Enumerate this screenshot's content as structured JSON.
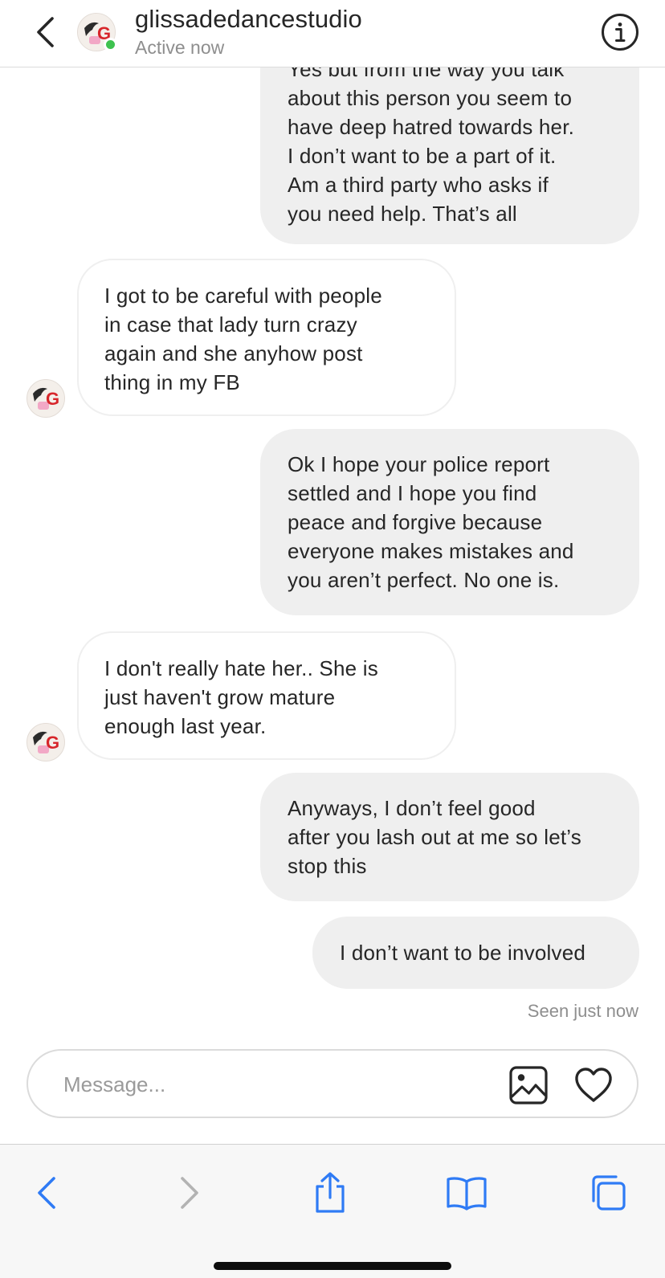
{
  "header": {
    "username": "glissadedancestudio",
    "status": "Active now"
  },
  "messages": [
    {
      "sender": "me",
      "lines": [
        "Yes but from the way you talk",
        "about this person you seem to",
        "have deep hatred towards her.",
        "I don’t want to be a part of it.",
        "Am a third party who asks if",
        "you need help. That’s all"
      ]
    },
    {
      "sender": "them",
      "lines": [
        "I got to be careful with people",
        "in case that lady turn crazy",
        "again and she anyhow post",
        "thing in my FB"
      ]
    },
    {
      "sender": "me",
      "lines": [
        "Ok I hope your police report",
        "settled and I hope you find",
        "peace and forgive because",
        "everyone makes mistakes and",
        "you aren’t perfect. No one is."
      ]
    },
    {
      "sender": "them",
      "lines": [
        "I don't really hate her.. She is",
        "just haven't grow mature",
        "enough last year."
      ]
    },
    {
      "sender": "me",
      "lines": [
        "Anyways, I don’t feel good",
        "after you lash out at me so let’s",
        "stop this"
      ]
    },
    {
      "sender": "me",
      "lines": [
        "I don’t want to be involved"
      ]
    }
  ],
  "seen_status": "Seen just now",
  "composer": {
    "placeholder": "Message..."
  },
  "icons": {
    "back": "chevron-left-icon",
    "info": "info-icon",
    "gallery": "image-icon",
    "like": "heart-icon",
    "browser_back": "browser-back-icon",
    "browser_forward": "browser-forward-icon",
    "share": "share-icon",
    "bookmarks": "bookmarks-icon",
    "tabs": "tabs-icon"
  },
  "colors": {
    "sent_bubble": "#efefef",
    "online": "#3ec24f",
    "toolbar_accent": "#2f7bf5",
    "toolbar_disabled": "#b3b3b3"
  }
}
